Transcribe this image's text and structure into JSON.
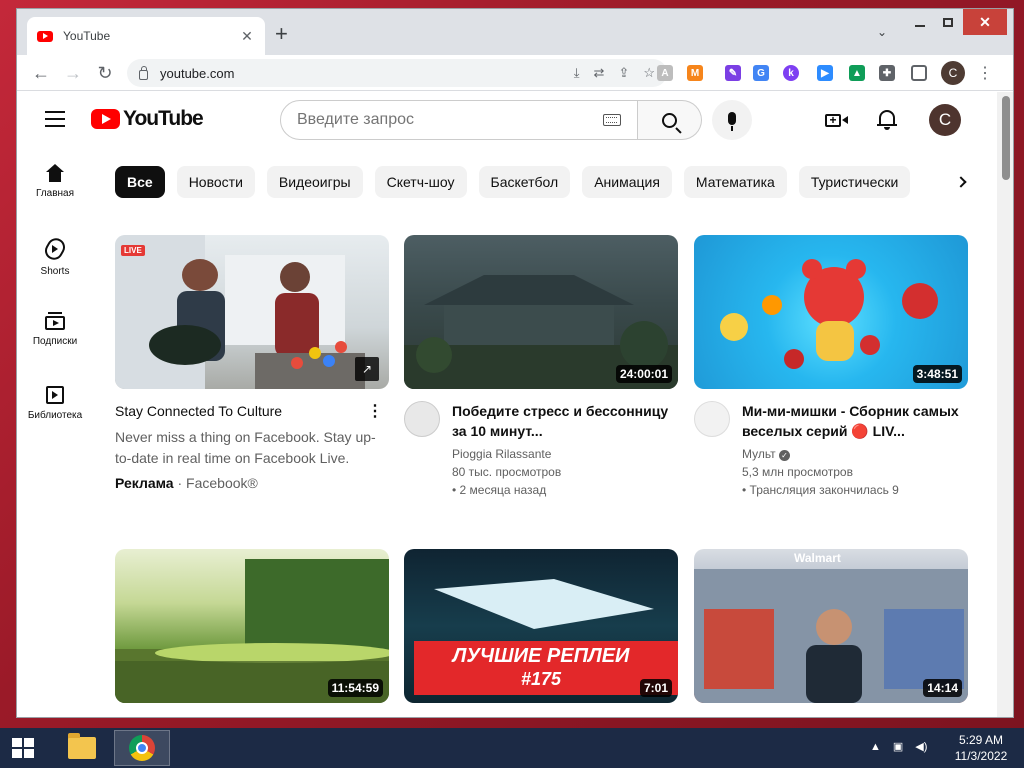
{
  "browser": {
    "tab_title": "YouTube",
    "url": "youtube.com",
    "profile_initial": "C"
  },
  "youtube": {
    "logo_text": "YouTube",
    "search_placeholder": "Введите запрос",
    "avatar_initial": "C",
    "rail": [
      {
        "label": "Главная",
        "icon": "home-icon"
      },
      {
        "label": "Shorts",
        "icon": "shorts-icon"
      },
      {
        "label": "Подписки",
        "icon": "subscriptions-icon"
      },
      {
        "label": "Библиотека",
        "icon": "library-icon"
      }
    ],
    "chips": [
      "Все",
      "Новости",
      "Видеоигры",
      "Скетч-шоу",
      "Баскетбол",
      "Анимация",
      "Математика",
      "Туристически"
    ],
    "videos": [
      {
        "title": "Stay Connected To Culture",
        "description": "Never miss a thing on Facebook. Stay up-to-date in real time on Facebook Live.",
        "ad_label": "Реклама",
        "advertiser": "Facebook®",
        "live_badge": "LIVE"
      },
      {
        "title": "Победите стресс и бессонницу за 10 минут...",
        "channel": "Pioggia Rilassante",
        "views": "80 тыс. просмотров",
        "age": "2 месяца назад",
        "duration": "24:00:01"
      },
      {
        "title": "Ми-ми-мишки - Сборник самых веселых серий 🔴 LIV...",
        "channel": "Мульт",
        "views": "5,3 млн просмотров",
        "age": "Трансляция закончилась 9",
        "duration": "3:48:51"
      },
      {
        "duration": "11:54:59"
      },
      {
        "duration": "7:01",
        "thumb_text_1": "ЛУЧШИЕ РЕПЛЕИ",
        "thumb_text_2": "#175"
      },
      {
        "duration": "14:14",
        "thumb_text": "Walmart"
      }
    ]
  },
  "taskbar": {
    "time": "5:29 AM",
    "date": "11/3/2022"
  }
}
